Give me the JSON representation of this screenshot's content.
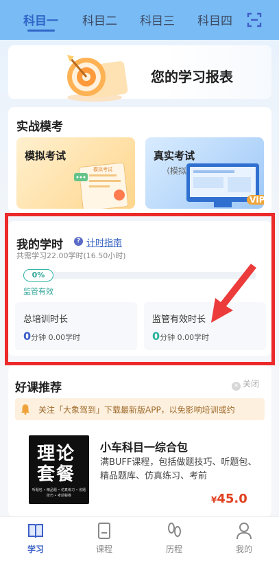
{
  "tabs": [
    {
      "label": "科目一",
      "active": true
    },
    {
      "label": "科目二",
      "active": false
    },
    {
      "label": "科目三",
      "active": false
    },
    {
      "label": "科目四",
      "active": false
    }
  ],
  "report": {
    "title": "您的学习报表"
  },
  "exam": {
    "section_title": "实战模考",
    "mock_label": "模拟考试",
    "real_label": "真实考试",
    "real_sub": "（模拟）",
    "mock_sheet_text": "模拟考试",
    "vip_badge": "VIP"
  },
  "hours": {
    "title": "我的学时",
    "help_glyph": "?",
    "guide_link": "计时指南",
    "subtitle": "共需学习22.00学时(16.50小时)",
    "progress_text": "0%",
    "progress_value": 0,
    "supervise_text": "监管有效",
    "total_label": "总培训时长",
    "total_num": "0",
    "total_unit": "分钟 0.00学时",
    "valid_label": "监管有效时长",
    "valid_num": "0",
    "valid_unit": "分钟 0.00学时"
  },
  "courses": {
    "section_title": "好课推荐",
    "close_label": "关闭",
    "close_glyph": "×",
    "notice": "关注「大象驾到」下载最新版APP，以免影响培训或约",
    "item": {
      "cover_line1": "理论",
      "cover_line2": "套餐",
      "cover_tags": "听题包 • 精品题 • 仿真练习 • 省题技巧 • 考前秘卷",
      "name": "小车科目一综合包",
      "desc": "满BUFF课程，包括做题技巧、听题包、精品题库、仿真练习、考前",
      "price_symbol": "¥",
      "price": "45.0"
    }
  },
  "nav": [
    {
      "label": "学习",
      "icon": "book-open-icon",
      "active": true
    },
    {
      "label": "课程",
      "icon": "document-icon",
      "active": false
    },
    {
      "label": "历程",
      "icon": "footprints-icon",
      "active": false
    },
    {
      "label": "我的",
      "icon": "user-icon",
      "active": false
    }
  ],
  "colors": {
    "accent": "#2f66c7",
    "highlight": "#ec2a2a",
    "teal": "#30a597",
    "price": "#e0401f"
  }
}
